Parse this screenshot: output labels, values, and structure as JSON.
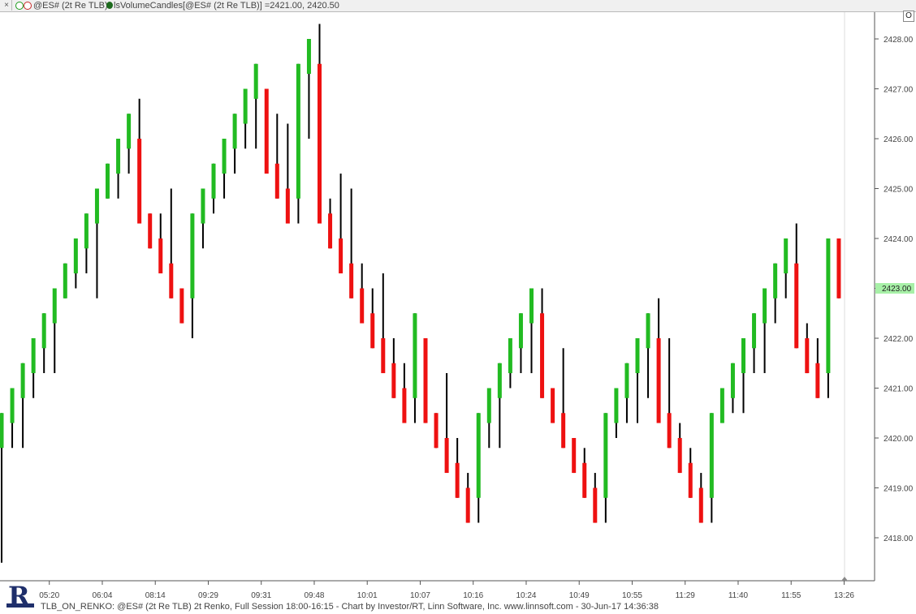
{
  "titlebar": {
    "close_label": "×",
    "series_label": "@ES# (2t Re TLB)",
    "indicator_label": "lsVolumeCandles[@ES# (2t Re TLB)] =2421.00, 2420.50"
  },
  "o_button": "O",
  "footer": "TLB_ON_RENKO: @ES# (2t Re TLB) 2t Renko, Full Session 18:00-16:15 - Chart by Investor/RT, Linn Software, Inc. www.linnsoft.com - 30-Jun-17 14:36:38",
  "logo_icon": "investor-rt-logo-icon",
  "colors": {
    "up": "#22bb22",
    "down": "#ee1111",
    "wick": "#000000",
    "price_marker": "#a7f0a7"
  },
  "chart_data": {
    "type": "candlestick",
    "ylim": [
      2417.25,
      2428.75
    ],
    "y_ticks": [
      2418,
      2419,
      2420,
      2421,
      2422,
      2423,
      2424,
      2425,
      2426,
      2427,
      2428
    ],
    "y_tick_labels": [
      "2418.00",
      "2419.00",
      "2420.00",
      "2421.00",
      "2422.00",
      "2423.00",
      "2424.00",
      "2425.00",
      "2426.00",
      "2427.00",
      "2428.00"
    ],
    "x_tick_labels": [
      "05:20",
      "06:04",
      "08:14",
      "09:29",
      "09:31",
      "09:48",
      "10:01",
      "10:07",
      "10:16",
      "10:24",
      "10:49",
      "10:55",
      "11:29",
      "11:40",
      "11:55",
      "13:26"
    ],
    "x_tick_bar_index": [
      4.5,
      9.5,
      14.5,
      19.5,
      24.5,
      29.5,
      34.5,
      39.5,
      44.5,
      49.5,
      54.5,
      59.5,
      64.5,
      69.5,
      74.5,
      79.5
    ],
    "last_price_label": "2423.00",
    "bars": [
      {
        "dir": "up",
        "open": 2419.8,
        "close": 2420.5,
        "high": 2420.5,
        "low": 2417.5
      },
      {
        "dir": "up",
        "open": 2420.3,
        "close": 2421.0,
        "high": 2421.0,
        "low": 2419.8
      },
      {
        "dir": "up",
        "open": 2420.8,
        "close": 2421.5,
        "high": 2421.5,
        "low": 2419.8
      },
      {
        "dir": "up",
        "open": 2421.3,
        "close": 2422.0,
        "high": 2422.0,
        "low": 2420.8
      },
      {
        "dir": "up",
        "open": 2421.8,
        "close": 2422.5,
        "high": 2422.5,
        "low": 2421.3
      },
      {
        "dir": "up",
        "open": 2422.3,
        "close": 2423.0,
        "high": 2423.0,
        "low": 2421.3
      },
      {
        "dir": "up",
        "open": 2422.8,
        "close": 2423.5,
        "high": 2423.5,
        "low": 2422.8
      },
      {
        "dir": "up",
        "open": 2423.3,
        "close": 2424.0,
        "high": 2424.0,
        "low": 2423.0
      },
      {
        "dir": "up",
        "open": 2423.8,
        "close": 2424.5,
        "high": 2424.5,
        "low": 2423.3
      },
      {
        "dir": "up",
        "open": 2424.3,
        "close": 2425.0,
        "high": 2425.0,
        "low": 2422.8
      },
      {
        "dir": "up",
        "open": 2424.8,
        "close": 2425.5,
        "high": 2425.5,
        "low": 2424.8
      },
      {
        "dir": "up",
        "open": 2425.3,
        "close": 2426.0,
        "high": 2426.0,
        "low": 2424.8
      },
      {
        "dir": "up",
        "open": 2425.8,
        "close": 2426.5,
        "high": 2426.5,
        "low": 2425.3
      },
      {
        "dir": "down",
        "open": 2426.0,
        "close": 2424.3,
        "high": 2426.8,
        "low": 2424.3
      },
      {
        "dir": "down",
        "open": 2424.5,
        "close": 2423.8,
        "high": 2424.5,
        "low": 2423.8
      },
      {
        "dir": "down",
        "open": 2424.0,
        "close": 2423.3,
        "high": 2424.5,
        "low": 2423.3
      },
      {
        "dir": "down",
        "open": 2423.5,
        "close": 2422.8,
        "high": 2425.0,
        "low": 2422.8
      },
      {
        "dir": "down",
        "open": 2423.0,
        "close": 2422.3,
        "high": 2423.0,
        "low": 2422.3
      },
      {
        "dir": "up",
        "open": 2422.8,
        "close": 2424.5,
        "high": 2424.5,
        "low": 2422.0
      },
      {
        "dir": "up",
        "open": 2424.3,
        "close": 2425.0,
        "high": 2425.0,
        "low": 2423.8
      },
      {
        "dir": "up",
        "open": 2424.8,
        "close": 2425.5,
        "high": 2425.5,
        "low": 2424.5
      },
      {
        "dir": "up",
        "open": 2425.3,
        "close": 2426.0,
        "high": 2426.0,
        "low": 2424.8
      },
      {
        "dir": "up",
        "open": 2425.8,
        "close": 2426.5,
        "high": 2426.5,
        "low": 2425.3
      },
      {
        "dir": "up",
        "open": 2426.3,
        "close": 2427.0,
        "high": 2427.0,
        "low": 2425.8
      },
      {
        "dir": "up",
        "open": 2426.8,
        "close": 2427.5,
        "high": 2427.5,
        "low": 2425.8
      },
      {
        "dir": "down",
        "open": 2427.0,
        "close": 2425.3,
        "high": 2427.0,
        "low": 2425.3
      },
      {
        "dir": "down",
        "open": 2425.5,
        "close": 2424.8,
        "high": 2426.5,
        "low": 2424.8
      },
      {
        "dir": "down",
        "open": 2425.0,
        "close": 2424.3,
        "high": 2426.3,
        "low": 2424.3
      },
      {
        "dir": "up",
        "open": 2424.8,
        "close": 2427.5,
        "high": 2427.5,
        "low": 2424.3
      },
      {
        "dir": "up",
        "open": 2427.3,
        "close": 2428.0,
        "high": 2428.0,
        "low": 2426.0
      },
      {
        "dir": "down",
        "open": 2427.5,
        "close": 2424.3,
        "high": 2428.3,
        "low": 2424.3
      },
      {
        "dir": "down",
        "open": 2424.5,
        "close": 2423.8,
        "high": 2424.8,
        "low": 2423.8
      },
      {
        "dir": "down",
        "open": 2424.0,
        "close": 2423.3,
        "high": 2425.3,
        "low": 2423.3
      },
      {
        "dir": "down",
        "open": 2423.5,
        "close": 2422.8,
        "high": 2425.0,
        "low": 2422.8
      },
      {
        "dir": "down",
        "open": 2423.0,
        "close": 2422.3,
        "high": 2423.5,
        "low": 2422.3
      },
      {
        "dir": "down",
        "open": 2422.5,
        "close": 2421.8,
        "high": 2423.0,
        "low": 2421.8
      },
      {
        "dir": "down",
        "open": 2422.0,
        "close": 2421.3,
        "high": 2423.3,
        "low": 2421.3
      },
      {
        "dir": "down",
        "open": 2421.5,
        "close": 2420.8,
        "high": 2422.0,
        "low": 2420.8
      },
      {
        "dir": "down",
        "open": 2421.0,
        "close": 2420.3,
        "high": 2421.5,
        "low": 2420.3
      },
      {
        "dir": "up",
        "open": 2420.8,
        "close": 2422.5,
        "high": 2422.5,
        "low": 2420.3
      },
      {
        "dir": "down",
        "open": 2422.0,
        "close": 2420.3,
        "high": 2422.0,
        "low": 2420.3
      },
      {
        "dir": "down",
        "open": 2420.5,
        "close": 2419.8,
        "high": 2420.5,
        "low": 2419.8
      },
      {
        "dir": "down",
        "open": 2420.0,
        "close": 2419.3,
        "high": 2421.3,
        "low": 2419.3
      },
      {
        "dir": "down",
        "open": 2419.5,
        "close": 2418.8,
        "high": 2420.0,
        "low": 2418.8
      },
      {
        "dir": "down",
        "open": 2419.0,
        "close": 2418.3,
        "high": 2419.3,
        "low": 2418.3
      },
      {
        "dir": "up",
        "open": 2418.8,
        "close": 2420.5,
        "high": 2420.5,
        "low": 2418.3
      },
      {
        "dir": "up",
        "open": 2420.3,
        "close": 2421.0,
        "high": 2421.0,
        "low": 2419.8
      },
      {
        "dir": "up",
        "open": 2420.8,
        "close": 2421.5,
        "high": 2421.5,
        "low": 2419.8
      },
      {
        "dir": "up",
        "open": 2421.3,
        "close": 2422.0,
        "high": 2422.0,
        "low": 2421.0
      },
      {
        "dir": "up",
        "open": 2421.8,
        "close": 2422.5,
        "high": 2422.5,
        "low": 2421.3
      },
      {
        "dir": "up",
        "open": 2422.3,
        "close": 2423.0,
        "high": 2423.0,
        "low": 2421.3
      },
      {
        "dir": "down",
        "open": 2422.5,
        "close": 2420.8,
        "high": 2423.0,
        "low": 2420.8
      },
      {
        "dir": "down",
        "open": 2421.0,
        "close": 2420.3,
        "high": 2421.0,
        "low": 2420.3
      },
      {
        "dir": "down",
        "open": 2420.5,
        "close": 2419.8,
        "high": 2421.8,
        "low": 2419.8
      },
      {
        "dir": "down",
        "open": 2420.0,
        "close": 2419.3,
        "high": 2420.0,
        "low": 2419.3
      },
      {
        "dir": "down",
        "open": 2419.5,
        "close": 2418.8,
        "high": 2419.8,
        "low": 2418.8
      },
      {
        "dir": "down",
        "open": 2419.0,
        "close": 2418.3,
        "high": 2419.3,
        "low": 2418.3
      },
      {
        "dir": "up",
        "open": 2418.8,
        "close": 2420.5,
        "high": 2420.5,
        "low": 2418.3
      },
      {
        "dir": "up",
        "open": 2420.3,
        "close": 2421.0,
        "high": 2421.0,
        "low": 2420.0
      },
      {
        "dir": "up",
        "open": 2420.8,
        "close": 2421.5,
        "high": 2421.5,
        "low": 2420.3
      },
      {
        "dir": "up",
        "open": 2421.3,
        "close": 2422.0,
        "high": 2422.0,
        "low": 2420.3
      },
      {
        "dir": "up",
        "open": 2421.8,
        "close": 2422.5,
        "high": 2422.5,
        "low": 2420.8
      },
      {
        "dir": "down",
        "open": 2422.0,
        "close": 2420.3,
        "high": 2422.8,
        "low": 2420.3
      },
      {
        "dir": "down",
        "open": 2420.5,
        "close": 2419.8,
        "high": 2422.0,
        "low": 2419.8
      },
      {
        "dir": "down",
        "open": 2420.0,
        "close": 2419.3,
        "high": 2420.3,
        "low": 2419.3
      },
      {
        "dir": "down",
        "open": 2419.5,
        "close": 2418.8,
        "high": 2419.8,
        "low": 2418.8
      },
      {
        "dir": "down",
        "open": 2419.0,
        "close": 2418.3,
        "high": 2419.3,
        "low": 2418.3
      },
      {
        "dir": "up",
        "open": 2418.8,
        "close": 2420.5,
        "high": 2420.5,
        "low": 2418.3
      },
      {
        "dir": "up",
        "open": 2420.3,
        "close": 2421.0,
        "high": 2421.0,
        "low": 2420.3
      },
      {
        "dir": "up",
        "open": 2420.8,
        "close": 2421.5,
        "high": 2421.5,
        "low": 2420.5
      },
      {
        "dir": "up",
        "open": 2421.3,
        "close": 2422.0,
        "high": 2422.0,
        "low": 2420.5
      },
      {
        "dir": "up",
        "open": 2421.8,
        "close": 2422.5,
        "high": 2422.5,
        "low": 2421.3
      },
      {
        "dir": "up",
        "open": 2422.3,
        "close": 2423.0,
        "high": 2423.0,
        "low": 2421.3
      },
      {
        "dir": "up",
        "open": 2422.8,
        "close": 2423.5,
        "high": 2423.5,
        "low": 2422.3
      },
      {
        "dir": "up",
        "open": 2423.3,
        "close": 2424.0,
        "high": 2424.0,
        "low": 2422.8
      },
      {
        "dir": "down",
        "open": 2423.5,
        "close": 2421.8,
        "high": 2424.3,
        "low": 2421.8
      },
      {
        "dir": "down",
        "open": 2422.0,
        "close": 2421.3,
        "high": 2422.3,
        "low": 2421.3
      },
      {
        "dir": "down",
        "open": 2421.5,
        "close": 2420.8,
        "high": 2422.0,
        "low": 2420.8
      },
      {
        "dir": "up",
        "open": 2421.3,
        "close": 2424.0,
        "high": 2424.0,
        "low": 2420.8
      },
      {
        "dir": "down",
        "open": 2424.0,
        "close": 2422.8,
        "high": 2424.0,
        "low": 2422.8
      }
    ]
  }
}
